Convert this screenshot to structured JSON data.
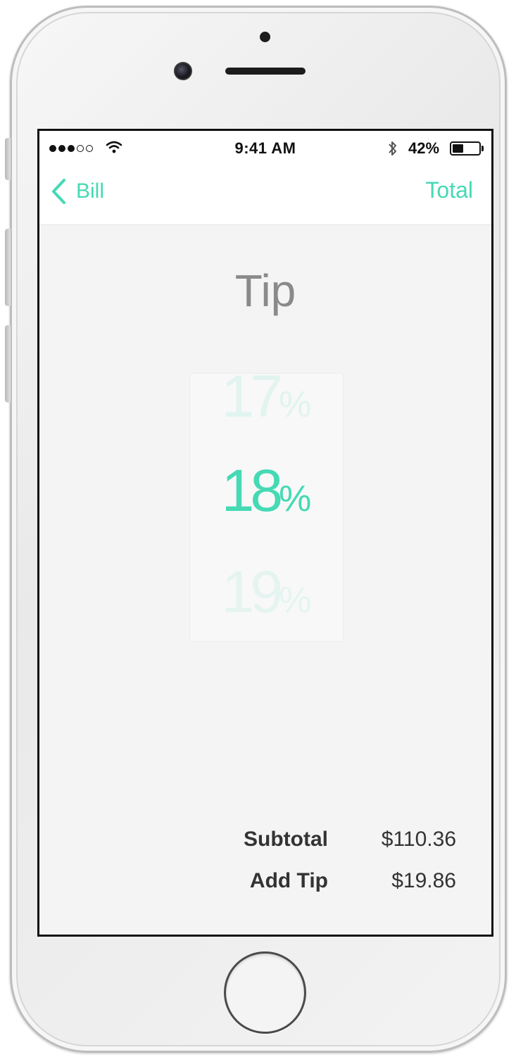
{
  "status_bar": {
    "time": "9:41 AM",
    "battery_percent": "42%",
    "battery_level": 0.42,
    "signal_bars_filled": 3,
    "signal_bars_total": 5,
    "icons": [
      "signal-dots-icon",
      "wifi-icon",
      "bluetooth-icon",
      "battery-icon"
    ]
  },
  "nav": {
    "back_label": "Bill",
    "back_icon": "chevron-left-icon",
    "right_label": "Total"
  },
  "page": {
    "title": "Tip"
  },
  "tip_picker": {
    "previous": {
      "value": "17",
      "unit": "%"
    },
    "selected": {
      "value": "18",
      "unit": "%"
    },
    "next": {
      "value": "19",
      "unit": "%"
    }
  },
  "summary": {
    "subtotal_label": "Subtotal",
    "subtotal_value": "$110.36",
    "tip_label": "Add Tip",
    "tip_value": "$19.86"
  },
  "colors": {
    "accent": "#45d9b4",
    "title_gray": "#8a8a8a",
    "text_dark": "#333333",
    "background": "#f4f4f4"
  }
}
